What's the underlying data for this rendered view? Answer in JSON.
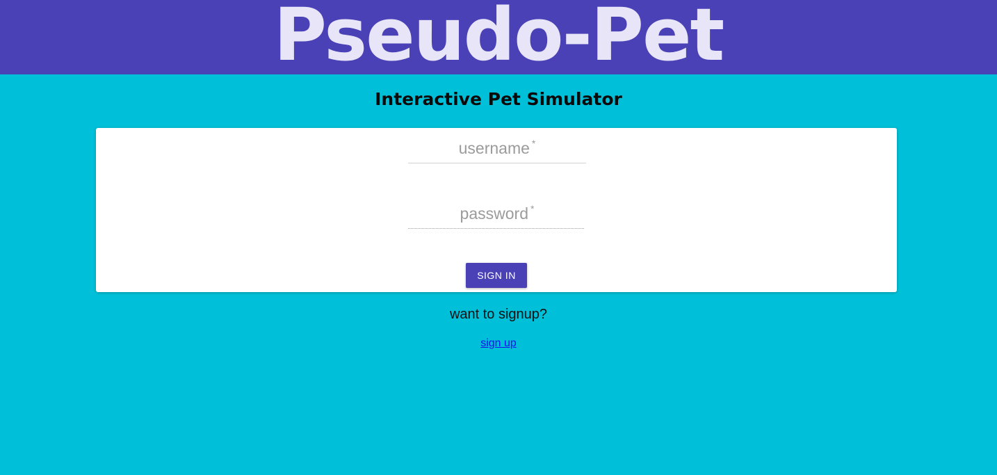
{
  "header": {
    "brand": "Pseudo-Pet",
    "background_color": "#4a41b6",
    "brand_color": "#e7e5f7"
  },
  "subtitle": "Interactive Pet Simulator",
  "page_background": "#00c0d9",
  "login_form": {
    "username": {
      "label": "username",
      "required_mark": "*",
      "value": ""
    },
    "password": {
      "label": "password",
      "required_mark": "*",
      "value": ""
    },
    "submit_label": "SIGN IN",
    "button_color": "#4a41b6"
  },
  "signup": {
    "prompt": "want to signup?",
    "link_label": "sign up"
  }
}
